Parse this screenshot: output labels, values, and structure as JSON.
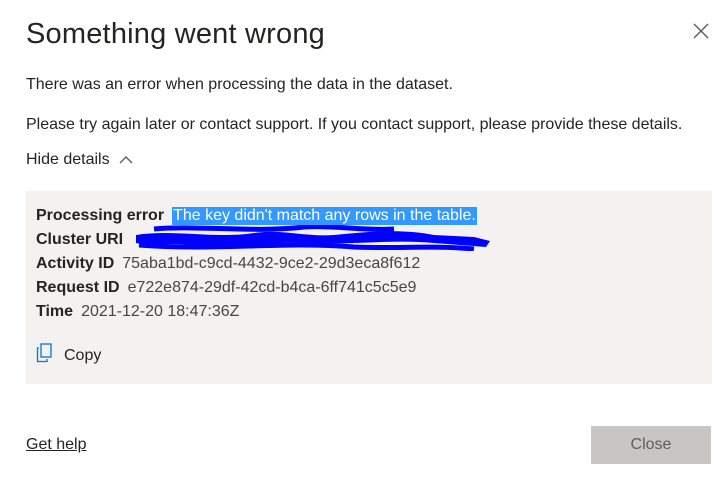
{
  "dialog": {
    "title": "Something went wrong",
    "message": "There was an error when processing the data in the dataset.",
    "instruction": "Please try again later or contact support. If you contact support, please provide these details.",
    "toggle_label": "Hide details",
    "details": {
      "processing_error_label": "Processing error",
      "processing_error_value": "The key didn't match any rows in the table.",
      "cluster_uri_label": "Cluster URI",
      "activity_id_label": "Activity ID",
      "activity_id_value": "75aba1bd-c9cd-4432-9ce2-29d3eca8f612",
      "request_id_label": "Request ID",
      "request_id_value": "e722e874-29df-42cd-b4ca-6ff741c5c5e9",
      "time_label": "Time",
      "time_value": "2021-12-20 18:47:36Z",
      "copy_label": "Copy"
    },
    "get_help_label": "Get help",
    "close_label": "Close"
  },
  "colors": {
    "highlight": "#3399ff",
    "redaction": "#0000ff",
    "details_background": "#f3f2f1",
    "close_button": "#c8c6c4"
  },
  "icons": {
    "close": "close-x-icon",
    "toggle": "chevron-up-icon",
    "copy": "copy-icon"
  }
}
